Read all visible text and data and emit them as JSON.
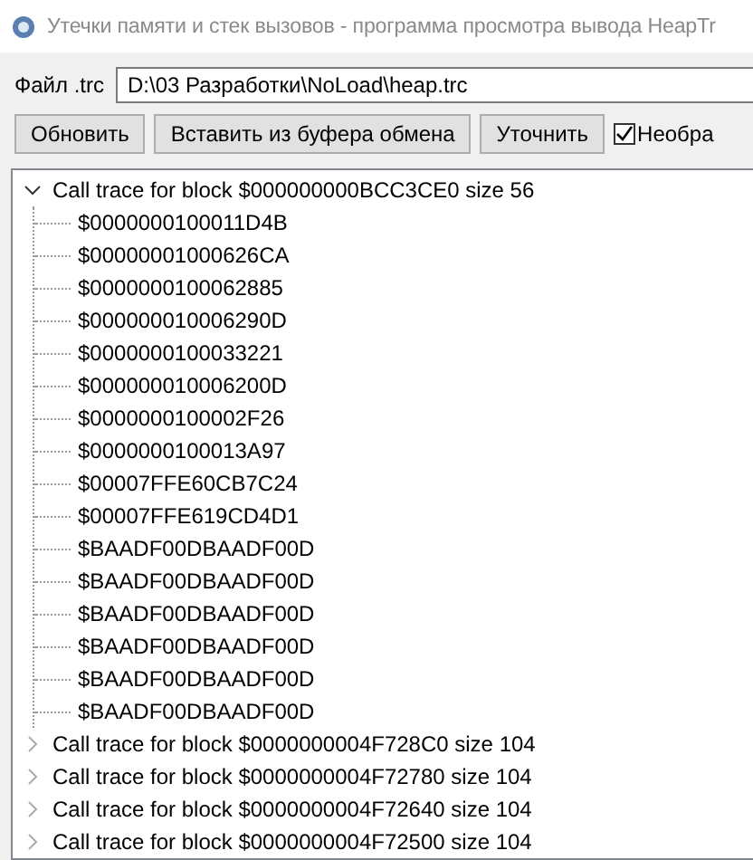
{
  "window": {
    "title": "Утечки памяти и стек вызовов - программа просмотра вывода HeapTr"
  },
  "file": {
    "label": "Файл .trc",
    "value": "D:\\03 Разработки\\NoLoad\\heap.trc"
  },
  "buttons": [
    "Обновить",
    "Вставить из буфера обмена",
    "Уточнить"
  ],
  "checkbox": {
    "label": "Необра",
    "checked": true
  },
  "tree": [
    {
      "label": "Call trace for block $000000000BCC3CE0 size 56",
      "expanded": true,
      "children": [
        {
          "label": "$0000000100011D4B"
        },
        {
          "label": "$00000001000626CA"
        },
        {
          "label": "$0000000100062885"
        },
        {
          "label": "$000000010006290D"
        },
        {
          "label": "$0000000100033221"
        },
        {
          "label": "$000000010006200D"
        },
        {
          "label": "$0000000100002F26"
        },
        {
          "label": "$0000000100013A97"
        },
        {
          "label": "$00007FFE60CB7C24"
        },
        {
          "label": "$00007FFE619CD4D1"
        },
        {
          "label": "$BAADF00DBAADF00D"
        },
        {
          "label": "$BAADF00DBAADF00D"
        },
        {
          "label": "$BAADF00DBAADF00D"
        },
        {
          "label": "$BAADF00DBAADF00D"
        },
        {
          "label": "$BAADF00DBAADF00D"
        },
        {
          "label": "$BAADF00DBAADF00D"
        }
      ]
    },
    {
      "label": "Call trace for block $0000000004F728C0 size 104",
      "expanded": false
    },
    {
      "label": "Call trace for block $0000000004F72780 size 104",
      "expanded": false
    },
    {
      "label": "Call trace for block $0000000004F72640 size 104",
      "expanded": false
    },
    {
      "label": "Call trace for block $0000000004F72500 size 104",
      "expanded": false
    }
  ]
}
